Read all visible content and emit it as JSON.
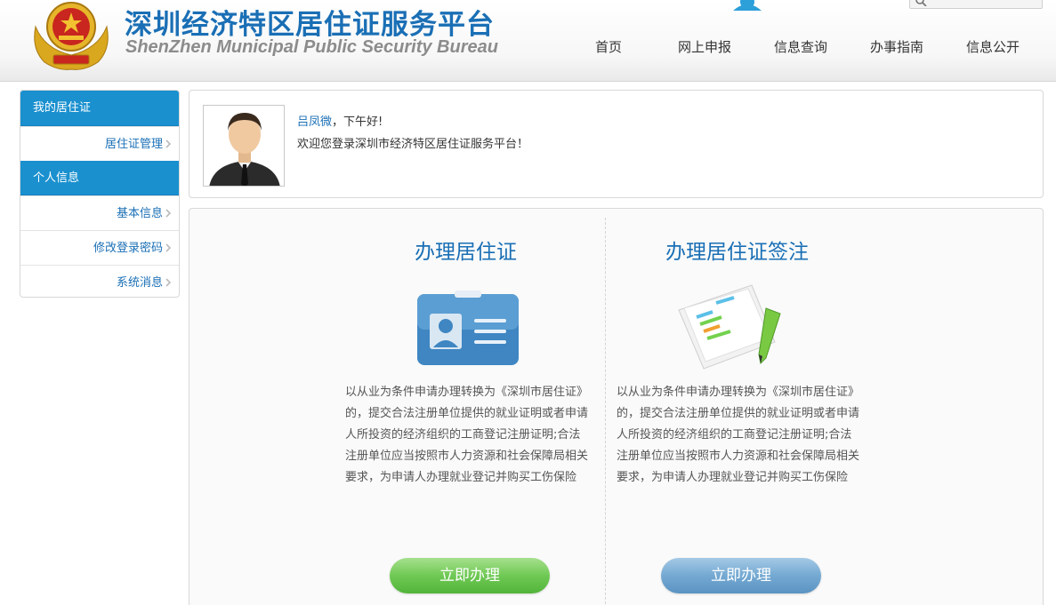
{
  "header": {
    "title_cn": "深圳经济特区居住证服务平台",
    "title_en": "ShenZhen Municipal Public Security Bureau",
    "nav": [
      "首页",
      "网上申报",
      "信息查询",
      "办事指南",
      "信息公开"
    ]
  },
  "sidebar": {
    "section1": {
      "label": "我的居住证",
      "items": [
        {
          "label": "居住证管理"
        }
      ]
    },
    "section2": {
      "label": "个人信息",
      "items": [
        {
          "label": "基本信息"
        },
        {
          "label": "修改登录密码"
        },
        {
          "label": "系统消息"
        }
      ]
    }
  },
  "welcome": {
    "username": "吕凤微",
    "greeting": "，下午好!",
    "message": "欢迎您登录深圳市经济特区居住证服务平台！"
  },
  "services": [
    {
      "title": "办理居住证",
      "description": "以从业为条件申请办理转换为《深圳市居住证》的，提交合法注册单位提供的就业证明或者申请人所投资的经济组织的工商登记注册证明;合法注册单位应当按照市人力资源和社会保障局相关要求，为申请人办理就业登记并购买工伤保险",
      "button": "立即办理",
      "icon": "id-card-icon"
    },
    {
      "title": "办理居住证签注",
      "description": "以从业为条件申请办理转换为《深圳市居住证》的，提交合法注册单位提供的就业证明或者申请人所投资的经济组织的工商登记注册证明;合法注册单位应当按照市人力资源和社会保障局相关要求，为申请人办理就业登记并购买工伤保险",
      "button": "立即办理",
      "icon": "document-pencil-icon"
    }
  ],
  "colors": {
    "brand_blue": "#1a6fb5",
    "sidebar_head": "#1a90cf",
    "button_green": "#6fc954",
    "button_blue": "#74a9d2"
  }
}
